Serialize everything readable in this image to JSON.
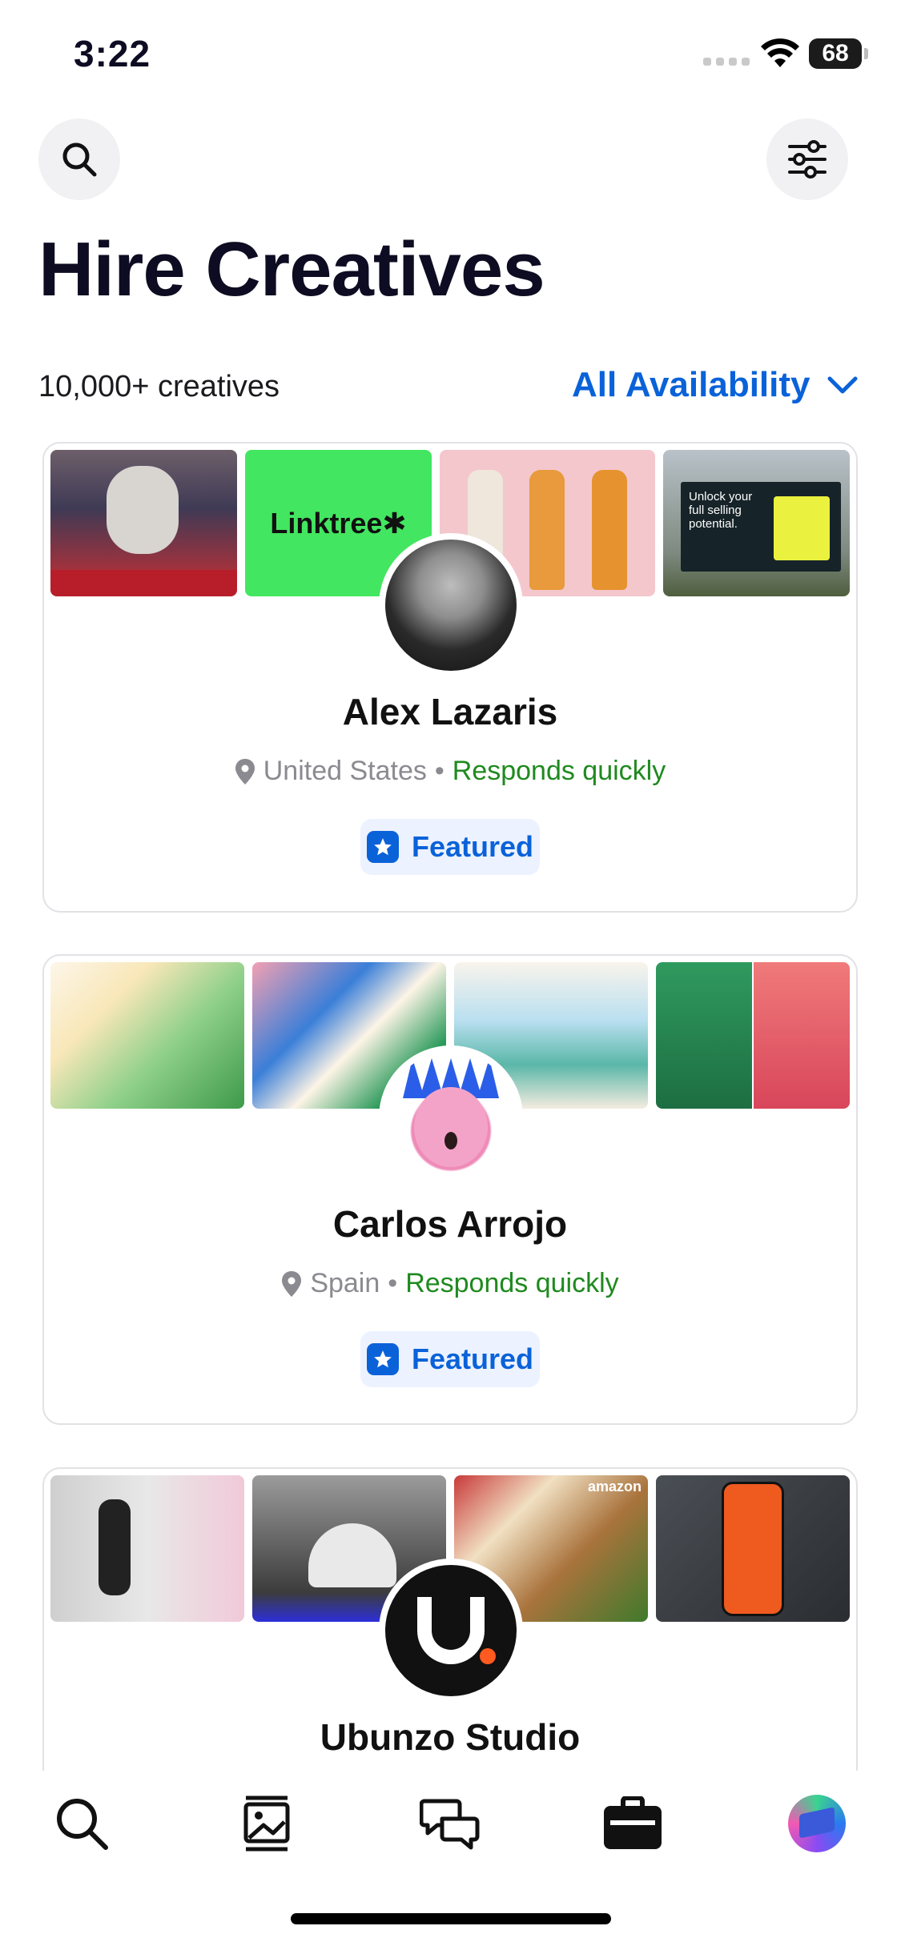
{
  "status": {
    "time": "3:22",
    "battery": "68"
  },
  "header": {
    "title": "Hire Creatives"
  },
  "filter": {
    "count": "10,000+ creatives",
    "availability": "All Availability"
  },
  "creatives": [
    {
      "name": "Alex Lazaris",
      "location": "United States",
      "responsiveness": "Responds quickly",
      "badge": "Featured",
      "thumbs": [
        "sloth-billboard",
        "linktree",
        "bottle-labels",
        "carbon-billboard"
      ],
      "thumb_text": {
        "linktree": "Linktree✱",
        "carbon": "Unlock your full selling potential."
      }
    },
    {
      "name": "Carlos Arrojo",
      "location": "Spain",
      "responsiveness": "Responds quickly",
      "badge": "Featured",
      "thumbs": [
        "illustration-1",
        "merry-christmas",
        "crystal-palace",
        "book-covers"
      ]
    },
    {
      "name": "Ubunzo Studio",
      "location": "",
      "responsiveness": "",
      "badge": "",
      "thumbs": [
        "doorbell",
        "dome-camera",
        "tacos",
        "energy-app"
      ],
      "thumb_text": {
        "tacos": "amazon"
      }
    }
  ],
  "nav": [
    "search-icon",
    "gallery-icon",
    "messages-icon",
    "briefcase-icon",
    "profile-avatar"
  ],
  "colors": {
    "accent": "#0a62d9",
    "responds": "#1f8a1f",
    "featured_bg": "#ecf2ff"
  }
}
